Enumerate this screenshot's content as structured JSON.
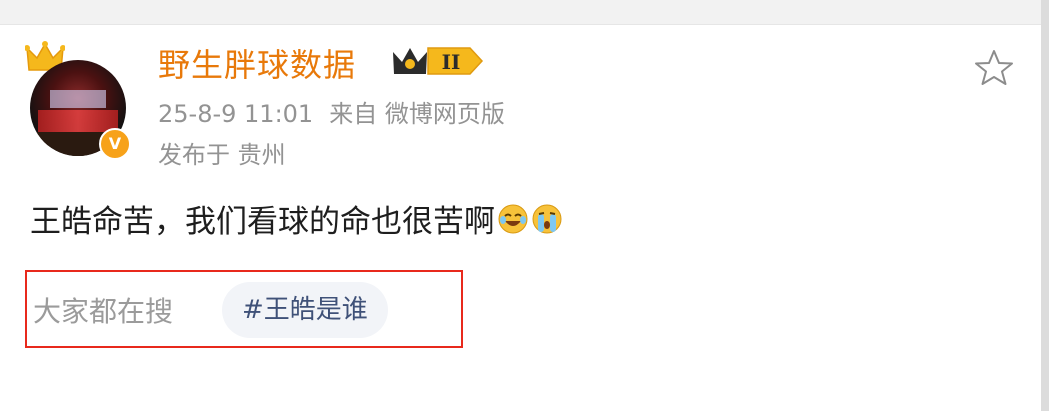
{
  "post": {
    "author": "野生胖球数据",
    "level": "II",
    "verified_mark": "V",
    "time": "25-8-9 11:01",
    "source": "来自 微博网页版",
    "location": "发布于 贵州",
    "text": "王皓命苦，我们看球的命也很苦啊",
    "emojis": [
      "crying-laugh-emoji",
      "sob-emoji"
    ]
  },
  "search": {
    "label": "大家都在搜",
    "topic": "#王皓是谁"
  },
  "colors": {
    "author": "#e8790a",
    "meta": "#939393",
    "topic": "#3f5178",
    "highlight": "#e8291c"
  }
}
